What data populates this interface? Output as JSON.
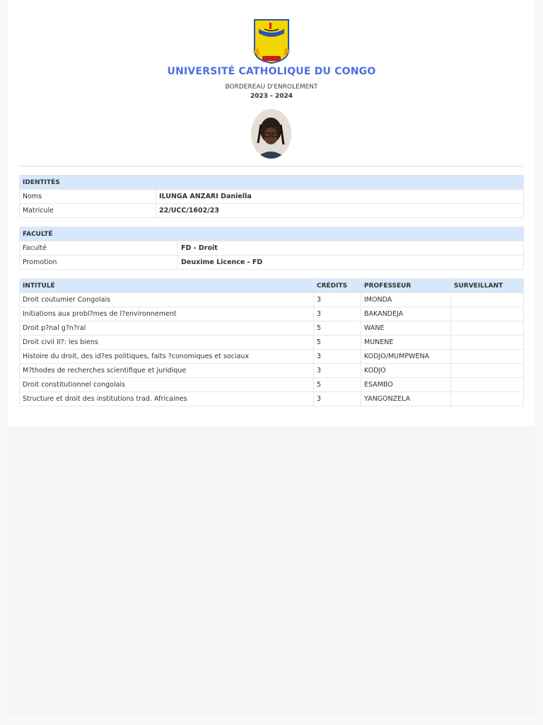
{
  "header": {
    "university": "UNIVERSITÉ CATHOLIQUE DU CONGO",
    "document_title": "BORDEREAU D'ENROLEMENT",
    "academic_year": "2023 - 2024"
  },
  "identites": {
    "heading": "IDENTITÉS",
    "rows": [
      {
        "label": "Noms",
        "value": "ILUNGA ANZARI Daniella"
      },
      {
        "label": "Matricule",
        "value": "22/UCC/1602/23"
      }
    ]
  },
  "faculte": {
    "heading": "FACULTÉ",
    "rows": [
      {
        "label": "Faculté",
        "value": "FD - Droit"
      },
      {
        "label": "Promotion",
        "value": "Deuxime Licence - FD"
      }
    ]
  },
  "courses": {
    "headers": [
      "INTITULÉ",
      "CRÉDITS",
      "PROFESSEUR",
      "SURVEILLANT"
    ],
    "rows": [
      {
        "intitule": "Droit coutumier Congolais",
        "credits": "3",
        "professeur": "IMONDA",
        "surveillant": ""
      },
      {
        "intitule": "Initiations aux probl?mes de l?environnement",
        "credits": "3",
        "professeur": "BAKANDEJA",
        "surveillant": ""
      },
      {
        "intitule": "Droit p?nal g?n?ral",
        "credits": "5",
        "professeur": "WANE",
        "surveillant": ""
      },
      {
        "intitule": "Droit civil II?: les biens",
        "credits": "5",
        "professeur": "MUNENE",
        "surveillant": ""
      },
      {
        "intitule": "Histoire du droit, des id?es politiques, faits ?conomiques et sociaux",
        "credits": "3",
        "professeur": "KODJO/MUMPWENA",
        "surveillant": ""
      },
      {
        "intitule": "M?thodes de recherches scientifique et juridique",
        "credits": "3",
        "professeur": "KODJO",
        "surveillant": ""
      },
      {
        "intitule": "Droit constitutionnel congolais",
        "credits": "5",
        "professeur": "ESAMBO",
        "surveillant": ""
      },
      {
        "intitule": "Structure et droit des institutions trad. Africaines",
        "credits": "3",
        "professeur": "YANGONZELA",
        "surveillant": ""
      }
    ]
  },
  "colors": {
    "title_blue": "#4c6fe0",
    "header_fill": "#d6e8fb"
  }
}
